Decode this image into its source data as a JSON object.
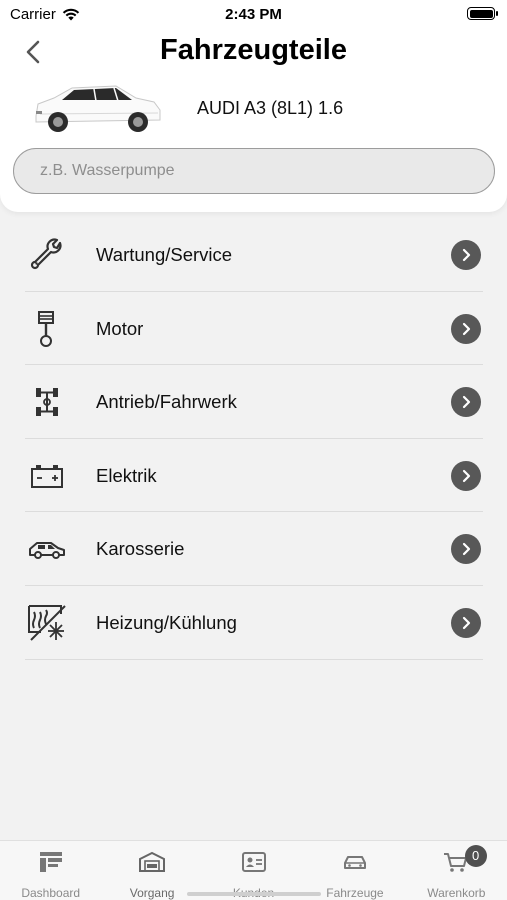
{
  "status_bar": {
    "carrier": "Carrier",
    "time": "2:43 PM"
  },
  "header": {
    "title": "Fahrzeugteile",
    "vehicle_name": "AUDI A3 (8L1) 1.6",
    "back_icon": "chevron-left-icon"
  },
  "search": {
    "placeholder": "z.B. Wasserpumpe",
    "value": ""
  },
  "categories": [
    {
      "label": "Wartung/Service",
      "icon": "wrench-icon"
    },
    {
      "label": "Motor",
      "icon": "piston-icon"
    },
    {
      "label": "Antrieb/Fahrwerk",
      "icon": "drivetrain-icon"
    },
    {
      "label": "Elektrik",
      "icon": "battery-icon"
    },
    {
      "label": "Karosserie",
      "icon": "car-body-icon"
    },
    {
      "label": "Heizung/Kühlung",
      "icon": "heating-cooling-icon"
    }
  ],
  "tabbar": {
    "items": [
      {
        "label": "Dashboard",
        "icon": "dashboard-icon"
      },
      {
        "label": "Vorgang",
        "icon": "garage-icon"
      },
      {
        "label": "Kunden",
        "icon": "contact-card-icon"
      },
      {
        "label": "Fahrzeuge",
        "icon": "car-icon"
      },
      {
        "label": "Warenkorb",
        "icon": "cart-icon",
        "badge": "0"
      }
    ]
  },
  "colors": {
    "chevron_bg": "#585858",
    "background": "#f2f2f2",
    "badge": "#505050"
  }
}
